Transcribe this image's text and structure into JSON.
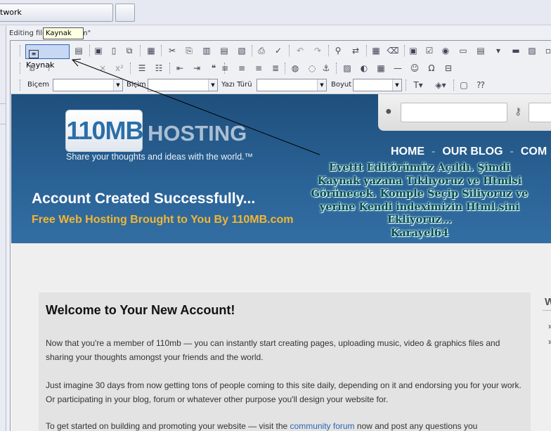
{
  "tabs": {
    "main_label": "twork"
  },
  "editing_label": "Editing file \"index.htm\"",
  "toolbar": {
    "source_label": "Kaynak",
    "tooltip": "Kaynak",
    "combo_style_label": "Biçem",
    "combo_format_label": "Biçim",
    "combo_font_label": "Yazı Türü",
    "combo_size_label": "Boyut"
  },
  "site": {
    "logo_number": "110MB",
    "logo_word": "HOSTING",
    "logo_tagline": "Share your thoughts and ideas with the world.™",
    "nav": [
      "HOME",
      "OUR BLOG",
      "COM"
    ],
    "hero_title": "Account Created Successfully...",
    "hero_subtitle": "Free Web Hosting Brought to You By 110MB.com",
    "welcome": "Welcome to Your New Account!",
    "p1": "Now that you're a member of 110mb — you can instantly start creating pages, uploading music, video & graphics files and sharing your thoughts amongst your friends and the world.",
    "p2": "Just imagine 30 days from now getting tons of people coming to this site daily, depending on it and endorsing you for your work. Or participating in your blog, forum or whatever other purpose you'll design your website for.",
    "p3_before": "To get started on building and promoting your website — visit the ",
    "p3_link": "community forum",
    "p3_after": " now and post any questions you",
    "side_heading": "W",
    "side_bullets": [
      "»",
      "»"
    ]
  },
  "annotation": {
    "lines": [
      "Evettt Editörümüz Açıldı. Şimdi",
      "Kaynak yazana Tıklıyoruz ve Htmlsi",
      "Görünecek. Komple Seçip Siliyoruz ve",
      "yerine Kendi indeximizin Html.sini",
      "Ekliyoruz...",
      "Karayel64"
    ]
  }
}
